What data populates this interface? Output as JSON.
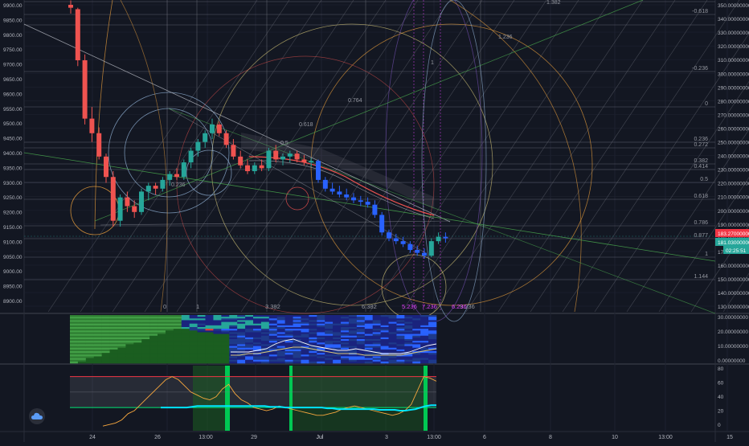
{
  "colors": {
    "background": "#131722",
    "grid": "#1e2230",
    "candle_up": "#26a69a",
    "candle_down": "#ef5350",
    "candle_down_blue": "#2962ff",
    "last_price_label": "#f23645",
    "secondary_price_label": "#26a69a",
    "time_label": "#26a69a",
    "fib_line": "#787b86",
    "fib_orange": "#f7a73e",
    "trend_green": "#4caf50",
    "trend_blue": "#9ec2e8",
    "pink": "#e040fb",
    "rsi_line": "#f7a73e",
    "rsi_cyan": "#00e5ff",
    "rsi_band_top": "#f23645"
  },
  "left_axis": {
    "ticks": [
      "9900.00",
      "9850.00",
      "9800.00",
      "9750.00",
      "9700.00",
      "9650.00",
      "9600.00",
      "9550.00",
      "9500.00",
      "9450.00",
      "9400.00",
      "9350.00",
      "9300.00",
      "9250.00",
      "9200.00",
      "9150.00",
      "9100.00",
      "9050.00",
      "9000.00",
      "8950.00",
      "8900.00"
    ]
  },
  "right_axis": {
    "ticks": [
      "350.00000000",
      "340.00000000",
      "330.00000000",
      "320.00000000",
      "310.00000000",
      "300.00000000",
      "290.00000000",
      "280.00000000",
      "270.00000000",
      "260.00000000",
      "250.00000000",
      "240.00000000",
      "230.00000000",
      "220.00000000",
      "210.00000000",
      "200.00000000",
      "190.00000000",
      "180.00000000",
      "170.00000000",
      "160.00000000",
      "150.00000000",
      "140.00000000",
      "130.00000000"
    ],
    "price_label_1": "183.27000000",
    "price_label_2": "181.03000000",
    "time_label": "02:25:51"
  },
  "fib_levels_right": [
    "1.382",
    "-0.618",
    "1.236",
    "-0.236",
    "0",
    "0.236",
    "0.272",
    "0.382",
    "0.414",
    "0.5",
    "0.618",
    "0.786",
    "0.877",
    "1",
    "1.144"
  ],
  "fib_levels_inner": [
    "0.764",
    "0.618",
    "0.5",
    "0.236"
  ],
  "fib_time_labels": [
    "0",
    "1",
    "3.382",
    "6.382",
    "5.236",
    "7.236",
    "9.236",
    "6.236"
  ],
  "fib_circle_label": "1",
  "pane2_axis": [
    "30.00000000",
    "20.00000000",
    "10.00000000",
    "0.00000000"
  ],
  "pane3_axis": [
    "80",
    "60",
    "40",
    "20",
    "0"
  ],
  "x_axis": [
    "24",
    "26",
    "13:00",
    "29",
    "Jul",
    "3",
    "13:00",
    "6",
    "8",
    "10",
    "13:00",
    "15"
  ],
  "chart_data": [
    {
      "type": "candlestick",
      "ylim": [
        8880,
        9910
      ],
      "y2lim": [
        125,
        355
      ],
      "candles": [
        [
          9910,
          9925,
          9880,
          9900
        ],
        [
          9895,
          9900,
          9700,
          9720
        ],
        [
          9720,
          9740,
          9500,
          9520
        ],
        [
          9520,
          9560,
          9440,
          9470
        ],
        [
          9470,
          9490,
          9380,
          9390
        ],
        [
          9390,
          9400,
          9300,
          9320
        ],
        [
          9320,
          9340,
          9150,
          9170
        ],
        [
          9170,
          9260,
          9150,
          9250
        ],
        [
          9250,
          9270,
          9200,
          9220
        ],
        [
          9220,
          9240,
          9180,
          9200
        ],
        [
          9200,
          9280,
          9190,
          9270
        ],
        [
          9270,
          9300,
          9240,
          9290
        ],
        [
          9290,
          9300,
          9260,
          9280
        ],
        [
          9280,
          9320,
          9270,
          9310
        ],
        [
          9310,
          9340,
          9290,
          9330
        ],
        [
          9330,
          9350,
          9310,
          9320
        ],
        [
          9320,
          9380,
          9310,
          9370
        ],
        [
          9370,
          9420,
          9350,
          9410
        ],
        [
          9410,
          9450,
          9390,
          9440
        ],
        [
          9440,
          9480,
          9420,
          9470
        ],
        [
          9470,
          9520,
          9450,
          9500
        ],
        [
          9500,
          9510,
          9460,
          9470
        ],
        [
          9470,
          9480,
          9420,
          9430
        ],
        [
          9430,
          9450,
          9380,
          9390
        ],
        [
          9390,
          9410,
          9350,
          9360
        ],
        [
          9360,
          9380,
          9330,
          9340
        ],
        [
          9340,
          9370,
          9330,
          9360
        ],
        [
          9360,
          9380,
          9340,
          9350
        ],
        [
          9350,
          9420,
          9340,
          9410
        ],
        [
          9410,
          9430,
          9370,
          9380
        ],
        [
          9380,
          9400,
          9360,
          9390
        ],
        [
          9390,
          9410,
          9370,
          9400
        ],
        [
          9400,
          9410,
          9370,
          9380
        ],
        [
          9380,
          9395,
          9360,
          9370
        ],
        [
          9370,
          9385,
          9355,
          9375
        ],
        [
          9375,
          9380,
          9300,
          9310
        ],
        [
          9310,
          9320,
          9270,
          9280
        ],
        [
          9280,
          9300,
          9260,
          9270
        ],
        [
          9270,
          9290,
          9250,
          9260
        ],
        [
          9260,
          9280,
          9240,
          9250
        ],
        [
          9250,
          9265,
          9230,
          9240
        ],
        [
          9240,
          9255,
          9220,
          9235
        ],
        [
          9235,
          9250,
          9215,
          9225
        ],
        [
          9225,
          9240,
          9180,
          9190
        ],
        [
          9190,
          9200,
          9120,
          9130
        ],
        [
          9130,
          9140,
          9100,
          9110
        ],
        [
          9110,
          9125,
          9090,
          9100
        ],
        [
          9100,
          9115,
          9080,
          9090
        ],
        [
          9090,
          9100,
          9060,
          9070
        ],
        [
          9070,
          9085,
          9050,
          9060
        ],
        [
          9060,
          9075,
          9040,
          9050
        ],
        [
          9050,
          9110,
          9045,
          9100
        ],
        [
          9100,
          9130,
          9090,
          9115
        ],
        [
          9115,
          9130,
          9095,
          9110
        ]
      ]
    },
    {
      "type": "heatmap",
      "ylim": [
        0,
        30
      ],
      "series": [
        {
          "name": "",
          "values": [
            7,
            7,
            7,
            8,
            9,
            12,
            14,
            15,
            13,
            11,
            10,
            9,
            8,
            8,
            9,
            8,
            7,
            6,
            6,
            6,
            7,
            9,
            11,
            12
          ]
        },
        {
          "name": "",
          "values": [
            5,
            5,
            6,
            6,
            7,
            8,
            9,
            10,
            10,
            9,
            8,
            7,
            6,
            6,
            6,
            5,
            5,
            5,
            5,
            5,
            6,
            7,
            8,
            9
          ]
        }
      ]
    },
    {
      "type": "line",
      "ylim": [
        0,
        80
      ],
      "bands": [
        30,
        70
      ],
      "series": [
        {
          "name": "",
          "values": [
            6,
            8,
            10,
            14,
            22,
            26,
            34,
            42,
            50,
            58,
            66,
            70,
            66,
            58,
            50,
            46,
            42,
            40,
            44,
            54,
            60,
            48,
            40,
            36,
            30,
            28,
            26,
            28,
            32,
            30,
            28,
            26,
            24,
            22,
            20,
            20,
            22,
            24,
            28,
            30,
            32,
            30,
            28,
            26,
            24,
            22,
            20,
            22,
            26,
            34,
            52,
            70,
            68,
            64
          ]
        },
        {
          "name": "",
          "values": [
            30,
            30,
            30,
            30,
            30,
            30,
            31,
            32,
            32,
            32,
            32,
            32,
            32,
            32,
            32,
            32,
            32,
            32,
            32,
            32,
            32,
            31,
            31,
            31,
            30,
            30,
            30,
            30,
            30,
            30,
            30,
            30,
            29,
            29,
            28,
            28,
            28,
            28,
            28,
            28,
            28,
            28,
            27,
            27,
            27,
            27,
            26,
            26,
            27,
            28,
            30,
            32,
            33,
            33
          ]
        }
      ]
    }
  ]
}
